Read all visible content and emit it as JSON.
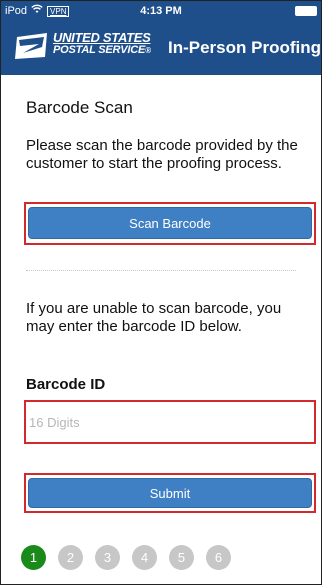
{
  "status_bar": {
    "device": "iPod",
    "vpn": "VPN",
    "time": "4:13 PM"
  },
  "header": {
    "brand_line1": "UNITED STATES",
    "brand_line2": "POSTAL SERVICE",
    "brand_mark": "®",
    "title": "In-Person Proofing"
  },
  "barcode_scan": {
    "heading": "Barcode Scan",
    "instructions": "Please scan the barcode provided by the customer to start the proofing process.",
    "scan_button_label": "Scan Barcode"
  },
  "manual_entry": {
    "instructions": "If you are unable to scan barcode, you may enter the barcode ID below.",
    "field_label": "Barcode ID",
    "field_value": "",
    "field_placeholder": "16 Digits",
    "submit_label": "Submit"
  },
  "progress": {
    "current_step": 1,
    "steps": [
      "1",
      "2",
      "3",
      "4",
      "5",
      "6"
    ]
  },
  "colors": {
    "header_bg": "#1f4f8b",
    "button_bg": "#3f7fc4",
    "highlight": "#d3282e",
    "active_step": "#1a8a1a",
    "inactive_step": "#c7c7c7"
  },
  "icons": [
    "wifi-icon",
    "battery-icon",
    "usps-eagle-logo-icon"
  ]
}
